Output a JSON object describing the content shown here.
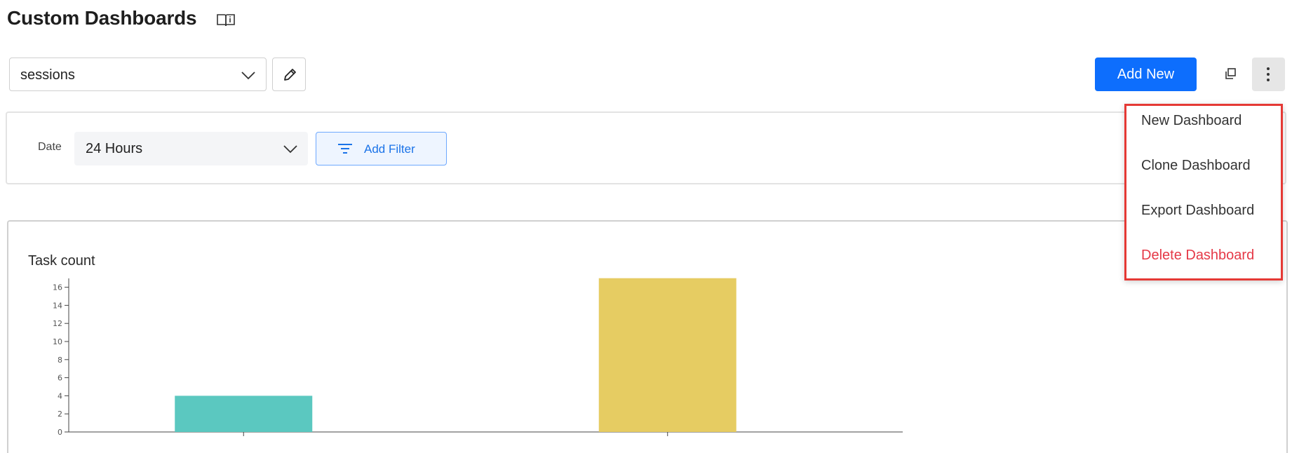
{
  "header": {
    "title": "Custom Dashboards",
    "info_icon": "book-icon"
  },
  "toolbar": {
    "dashboard_select": {
      "value": "sessions",
      "icon": "chevron-down-icon"
    },
    "edit_icon": "pencil-icon",
    "add_new_label": "Add New",
    "clone_icon": "copy-icon",
    "more_icon": "vertical-dots-icon",
    "accent_color": "#0d6efd"
  },
  "filters": {
    "date_label": "Date",
    "date_value": "24 Hours",
    "add_filter_label": "Add Filter",
    "add_filter_icon": "filter-lines-icon"
  },
  "menu": {
    "items": [
      {
        "label": "New Dashboard"
      },
      {
        "label": "Clone Dashboard"
      },
      {
        "label": "Export Dashboard"
      },
      {
        "label": "Delete Dashboard",
        "danger_color": "#e53947"
      }
    ],
    "highlight_border": "#e53935"
  },
  "chart_data": {
    "type": "bar",
    "title": "Task count",
    "y_ticks": [
      "0",
      "2",
      "4",
      "6",
      "8",
      "10",
      "12",
      "14",
      "16"
    ],
    "ylim": [
      0,
      16.9
    ],
    "series": [
      {
        "values": [
          4,
          17
        ],
        "colors": [
          "#5bc8c0",
          "#e6cc62"
        ]
      }
    ],
    "grid": false
  }
}
